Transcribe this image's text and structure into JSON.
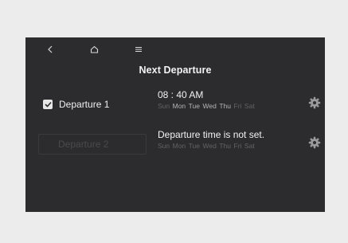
{
  "title": "Next Departure",
  "departures": [
    {
      "label": "Departure 1",
      "checked": true,
      "time": "08 : 40 AM",
      "days": [
        {
          "name": "Sun",
          "active": false
        },
        {
          "name": "Mon",
          "active": true
        },
        {
          "name": "Tue",
          "active": true
        },
        {
          "name": "Wed",
          "active": true
        },
        {
          "name": "Thu",
          "active": true
        },
        {
          "name": "Fri",
          "active": false
        },
        {
          "name": "Sat",
          "active": false
        }
      ]
    },
    {
      "label": "Departure 2",
      "checked": false,
      "time": "Departure time is not set.",
      "days": [
        {
          "name": "Sun",
          "active": false
        },
        {
          "name": "Mon",
          "active": false
        },
        {
          "name": "Tue",
          "active": false
        },
        {
          "name": "Wed",
          "active": false
        },
        {
          "name": "Thu",
          "active": false
        },
        {
          "name": "Fri",
          "active": false
        },
        {
          "name": "Sat",
          "active": false
        }
      ]
    }
  ],
  "icons": {
    "back": "back-arrow-icon",
    "home": "home-icon",
    "menu": "menu-icon",
    "settings": "gear-icon",
    "check": "checkmark-icon"
  }
}
